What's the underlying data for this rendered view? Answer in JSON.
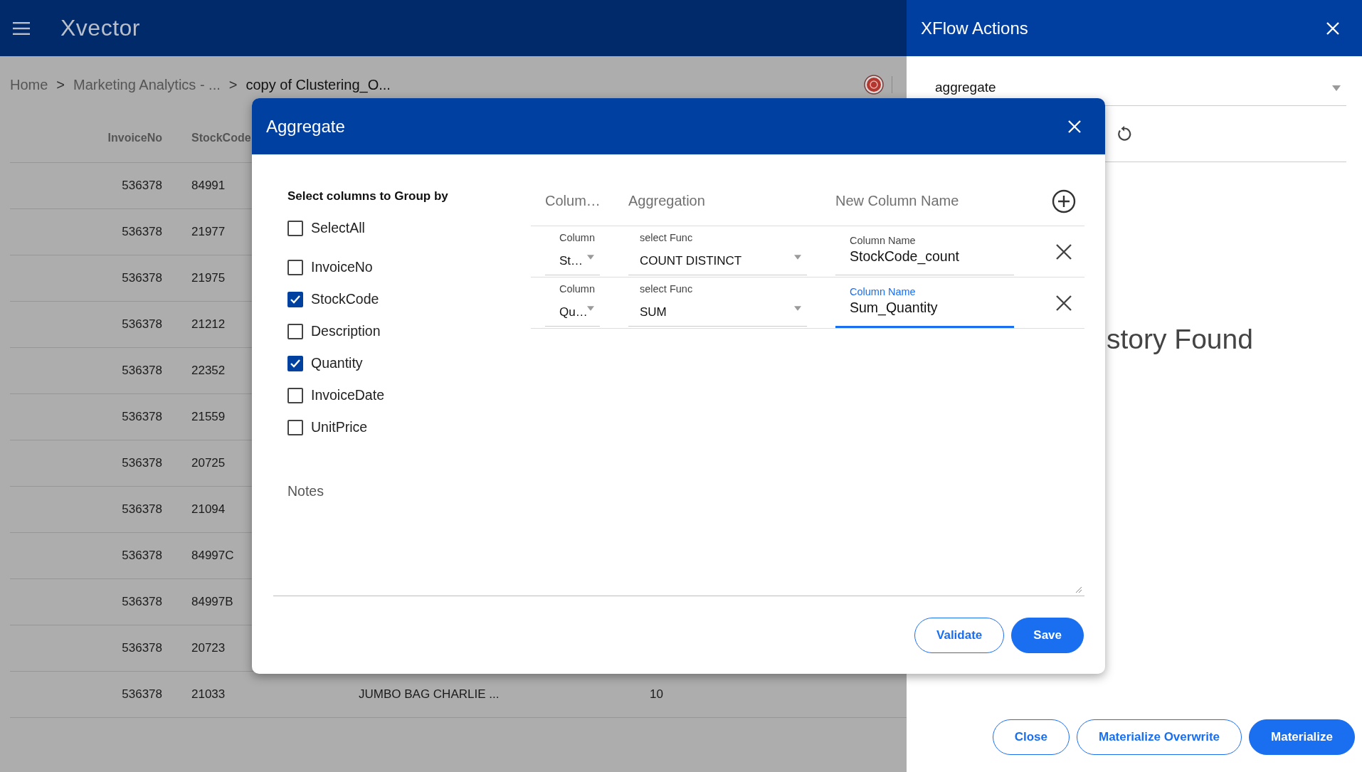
{
  "app_bar": {
    "logo": "Xvector"
  },
  "breadcrumb": [
    {
      "label": "Home",
      "current": false
    },
    {
      "label": "Marketing Analytics - ...",
      "current": false
    },
    {
      "label": "copy of Clustering_O...",
      "current": true
    }
  ],
  "breadcrumb_separators": [
    ">",
    ">"
  ],
  "table": {
    "columns": [
      "InvoiceNo",
      "StockCode"
    ],
    "rows": [
      [
        "536378",
        "84991"
      ],
      [
        "536378",
        "21977"
      ],
      [
        "536378",
        "21975"
      ],
      [
        "536378",
        "21212"
      ],
      [
        "536378",
        "22352"
      ],
      [
        "536378",
        "21559"
      ],
      [
        "536378",
        "20725"
      ],
      [
        "536378",
        "21094"
      ],
      [
        "536378",
        "84997C"
      ],
      [
        "536378",
        "84997B"
      ],
      [
        "536378",
        "20723"
      ],
      [
        "536378",
        "21033",
        "JUMBO BAG CHARLIE ...",
        "10"
      ]
    ]
  },
  "dialog": {
    "title": "Aggregate",
    "group_by": {
      "title": "Select columns to Group by",
      "items": [
        {
          "label": "SelectAll",
          "checked": false
        },
        {
          "label": "InvoiceNo",
          "checked": false
        },
        {
          "label": "StockCode",
          "checked": true
        },
        {
          "label": "Description",
          "checked": false
        },
        {
          "label": "Quantity",
          "checked": true
        },
        {
          "label": "InvoiceDate",
          "checked": false
        },
        {
          "label": "UnitPrice",
          "checked": false
        }
      ]
    },
    "aggregation_columns": [
      "Colum…",
      "Aggregation",
      "New Column Name"
    ],
    "aggregations": [
      {
        "column_label": "Column",
        "column": "St…",
        "func_label": "select Func",
        "func": "COUNT DISTINCT",
        "name_label": "Column Name",
        "name": "StockCode_count",
        "focused": false
      },
      {
        "column_label": "Column",
        "column": "Qu…",
        "func_label": "select Func",
        "func": "SUM",
        "name_label": "Column Name",
        "name": "Sum_Quantity",
        "focused": true
      }
    ],
    "notes": {
      "label": "Notes"
    },
    "buttons": [
      {
        "label": "Validate",
        "kind": "outlined"
      },
      {
        "label": "Save",
        "kind": "filled"
      }
    ]
  },
  "side_panel": {
    "title": "XFlow Actions",
    "action": {
      "value": "aggregate"
    },
    "message": "story Found",
    "buttons": [
      {
        "label": "Close",
        "kind": "outlined"
      },
      {
        "label": "Materialize Overwrite",
        "kind": "outlined"
      },
      {
        "label": "Materialize",
        "kind": "filled"
      }
    ]
  }
}
